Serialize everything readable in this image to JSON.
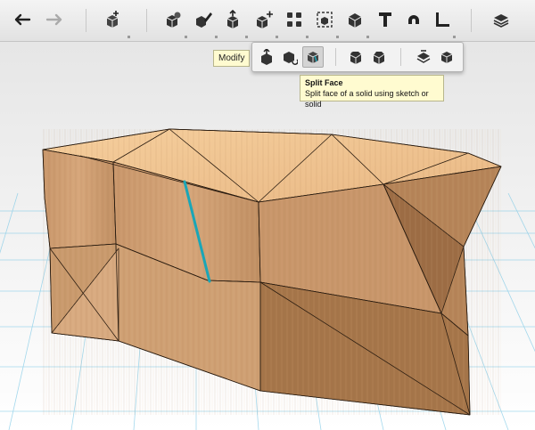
{
  "toolbar": {
    "buttons": [
      "undo-icon",
      "redo-icon",
      "import-icon",
      "primitives-icon",
      "sketch-icon",
      "construct-icon",
      "modify-icon",
      "pattern-icon",
      "group-icon",
      "combine-icon",
      "text-icon",
      "snap-icon",
      "measure-icon",
      "material-icon"
    ]
  },
  "modify_label": "Modify",
  "modify_menu": {
    "items": [
      "press-pull-icon",
      "tweak-icon",
      "split-face-icon",
      "fillet-icon",
      "chamfer-icon",
      "shell-icon",
      "split-solid-icon"
    ]
  },
  "tooltip": {
    "title": "Split Face",
    "description": "Split face of a solid using sketch or solid"
  },
  "colors": {
    "accent_edge": "#1aa6b7",
    "wood_light": "#f3c48f",
    "wood_mid": "#d4a378",
    "wood_dark": "#b07f55",
    "grid": "#7ec9e6"
  }
}
